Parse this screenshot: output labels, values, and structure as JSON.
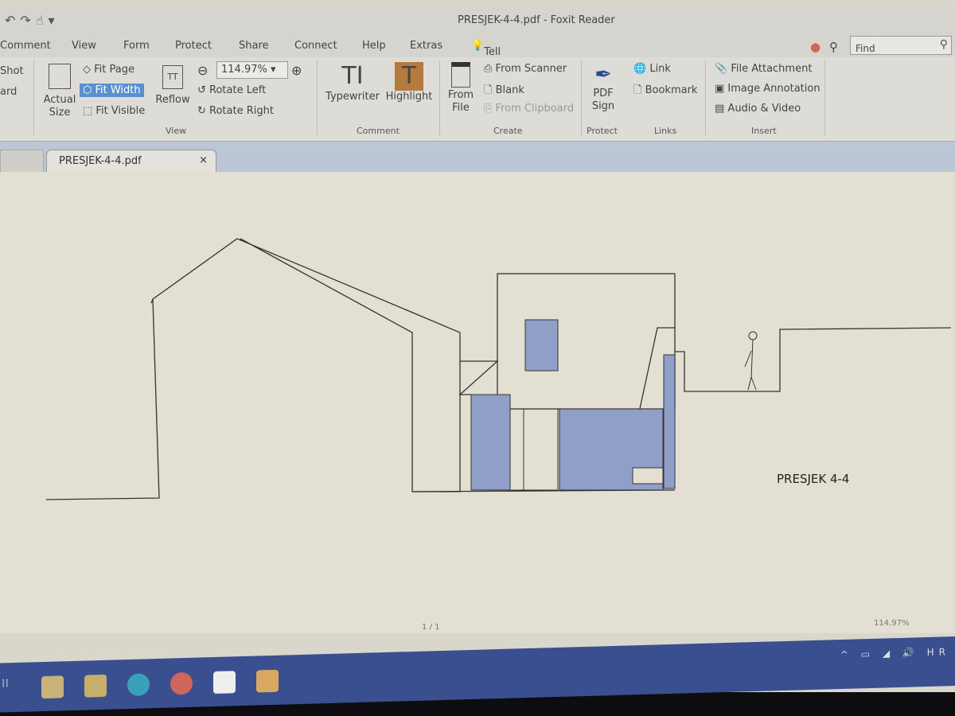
{
  "window": {
    "title": "PRESJEK-4-4.pdf - Foxit Reader",
    "quick_access": [
      "undo-icon",
      "redo-icon",
      "hand-icon"
    ]
  },
  "menu": [
    "Comment",
    "View",
    "Form",
    "Protect",
    "Share",
    "Connect",
    "Help",
    "Extras"
  ],
  "tell_me": "Tell me what you want to do..",
  "find_placeholder": "Find",
  "ribbon": {
    "left_partial": [
      "Shot",
      "ard"
    ],
    "view": {
      "actual_size": "Actual Size",
      "fit_page": "Fit Page",
      "fit_width": "Fit Width",
      "fit_visible": "Fit Visible",
      "reflow": "Reflow",
      "zoom": "114.97%",
      "rotate_left": "Rotate Left",
      "rotate_right": "Rotate Right",
      "group": "View"
    },
    "comment": {
      "typewriter": "Typewriter",
      "highlight": "Highlight",
      "group": "Comment"
    },
    "create": {
      "from_file": "From File",
      "from_scanner": "From Scanner",
      "blank": "Blank",
      "from_clipboard": "From Clipboard",
      "group": "Create"
    },
    "protect": {
      "pdf_sign": "PDF Sign",
      "group": "Protect"
    },
    "links": {
      "link": "Link",
      "bookmark": "Bookmark",
      "group": "Links"
    },
    "insert": {
      "file_attachment": "File Attachment",
      "image_annotation": "Image Annotation",
      "audio_video": "Audio & Video",
      "group": "Insert"
    }
  },
  "tab": {
    "label": "PRESJEK-4-4.pdf",
    "close": "×"
  },
  "document": {
    "label": "PRESJEK 4-4",
    "fill_color": "#8f9fc8"
  },
  "status": {
    "page": "1 / 1",
    "zoom": "114.97%"
  },
  "taskbar": {
    "color": "#3a4f8f",
    "tray": "HR"
  }
}
